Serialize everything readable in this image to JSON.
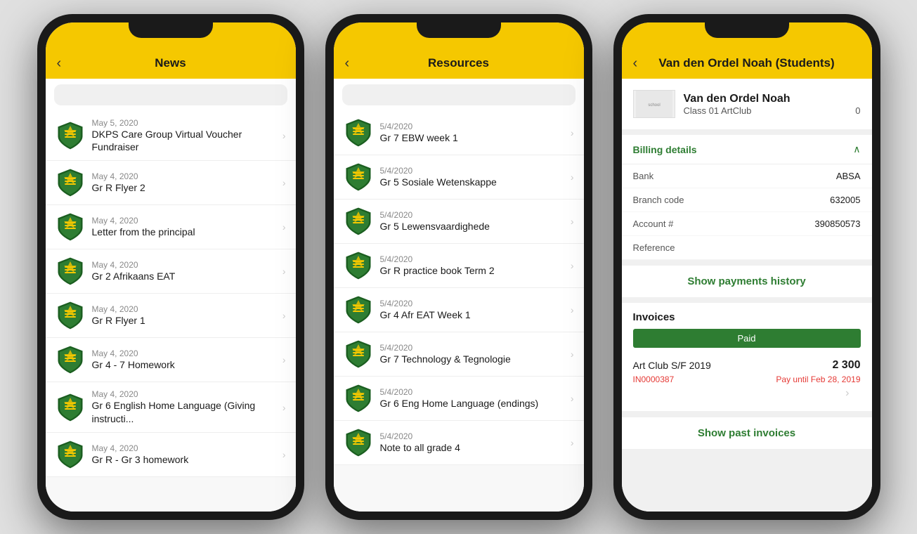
{
  "phone1": {
    "header": {
      "title": "News",
      "back": "‹"
    },
    "search": {
      "placeholder": ""
    },
    "items": [
      {
        "date": "May 5, 2020",
        "title": "DKPS Care Group Virtual Voucher Fundraiser"
      },
      {
        "date": "May 4, 2020",
        "title": "Gr R Flyer 2"
      },
      {
        "date": "May 4, 2020",
        "title": "Letter from the principal"
      },
      {
        "date": "May 4, 2020",
        "title": "Gr 2 Afrikaans EAT"
      },
      {
        "date": "May 4, 2020",
        "title": "Gr R Flyer 1"
      },
      {
        "date": "May 4, 2020",
        "title": "Gr 4 - 7 Homework"
      },
      {
        "date": "May 4, 2020",
        "title": "Gr 6 English Home Language (Giving instructi..."
      },
      {
        "date": "May 4, 2020",
        "title": "Gr R - Gr 3 homework"
      }
    ]
  },
  "phone2": {
    "header": {
      "title": "Resources",
      "back": "‹"
    },
    "search": {
      "placeholder": ""
    },
    "items": [
      {
        "date": "5/4/2020",
        "title": "Gr 7 EBW week 1"
      },
      {
        "date": "5/4/2020",
        "title": "Gr 5 Sosiale Wetenskappe"
      },
      {
        "date": "5/4/2020",
        "title": "Gr 5 Lewensvaardighede"
      },
      {
        "date": "5/4/2020",
        "title": "Gr R practice book Term 2"
      },
      {
        "date": "5/4/2020",
        "title": "Gr 4 Afr EAT Week 1"
      },
      {
        "date": "5/4/2020",
        "title": "Gr 7 Technology & Tegnologie"
      },
      {
        "date": "5/4/2020",
        "title": "Gr 6 Eng Home Language (endings)"
      },
      {
        "date": "5/4/2020",
        "title": "Note to all grade 4"
      }
    ]
  },
  "phone3": {
    "header": {
      "title": "Van den Ordel Noah (Students)",
      "back": "‹"
    },
    "profile": {
      "logo_text": "school logo",
      "name": "Van den Ordel Noah",
      "class": "Class 01 ArtClub",
      "class_num": "0"
    },
    "billing": {
      "title": "Billing details",
      "bank_label": "Bank",
      "bank_value": "ABSA",
      "branch_label": "Branch code",
      "branch_value": "632005",
      "account_label": "Account #",
      "account_value": "390850573",
      "reference_label": "Reference",
      "reference_value": ""
    },
    "payments_btn": "Show payments history",
    "invoices": {
      "title": "Invoices",
      "status": "Paid",
      "name": "Art Club S/F 2019",
      "amount": "2 300",
      "id": "IN0000387",
      "due": "Pay until Feb 28, 2019"
    },
    "show_past_btn": "Show past invoices"
  }
}
